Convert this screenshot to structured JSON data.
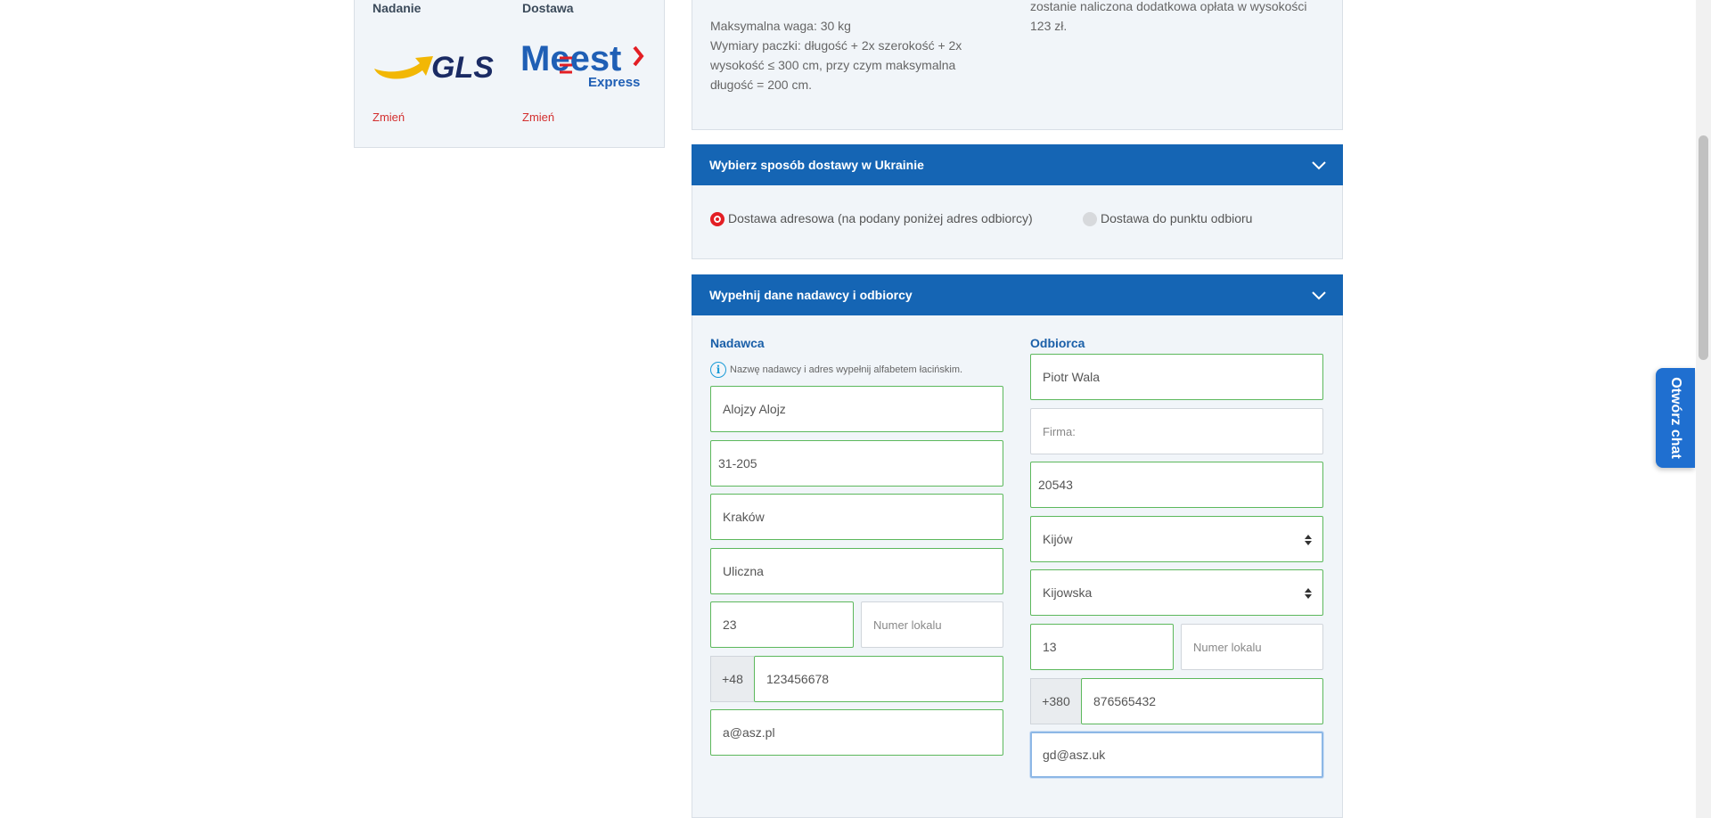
{
  "shipment_summary": {
    "pickup_label": "Nadanie",
    "delivery_label": "Dostawa",
    "pickup_carrier": "GLS",
    "delivery_carrier_main": "Meest",
    "delivery_carrier_sub": "Express",
    "change_label": "Zmień"
  },
  "parcel_info": {
    "max_weight": "Maksymalna waga: 30 kg",
    "dimensions": [
      "Wymiary paczki: długość + 2x szerokość + 2x",
      "wysokość ≤ 300 cm, przy czym maksymalna",
      "długość = 200 cm."
    ],
    "surcharge": [
      "zostanie naliczona dodatkowa opłata w wysokości",
      "123 zł."
    ]
  },
  "delivery_method": {
    "header": "Wybierz sposób dostawy w Ukrainie",
    "options": [
      {
        "label": "Dostawa adresowa (na podany poniżej adres odbiorcy)",
        "selected": true
      },
      {
        "label": "Dostawa do punktu odbioru",
        "selected": false
      }
    ]
  },
  "form": {
    "header": "Wypełnij dane nadawcy i odbiorcy",
    "sender": {
      "title": "Nadawca",
      "hint": "Nazwę nadawcy i adres wypełnij alfabetem łacińskim.",
      "name": "Alojzy Alojz",
      "postcode": "31-205",
      "city": "Kraków",
      "street": "Uliczna",
      "house_number": "23",
      "flat_placeholder": "Numer lokalu",
      "phone_prefix": "+48",
      "phone": "123456678",
      "email": "a@asz.pl"
    },
    "recipient": {
      "title": "Odbiorca",
      "name": "Piotr Wala",
      "company_placeholder": "Firma:",
      "postcode": "20543",
      "city": "Kijów",
      "street": "Kijowska",
      "house_number": "13",
      "flat_placeholder": "Numer lokalu",
      "phone_prefix": "+380",
      "phone": "876565432",
      "email": "gd@asz.uk"
    }
  },
  "chat": {
    "label": "Otwórz chat"
  },
  "colors": {
    "primary": "#1565b4",
    "accent_red": "#e31e24",
    "valid_border": "#5cb85c",
    "panel_bg": "#f1f5f9"
  }
}
